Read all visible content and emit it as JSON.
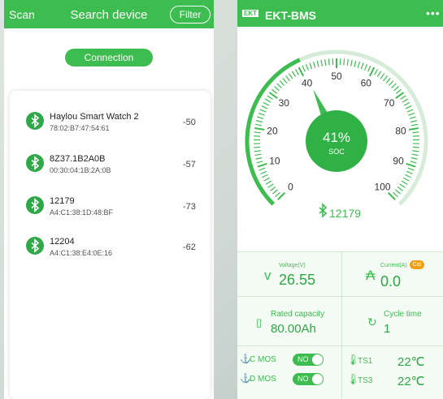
{
  "scan_screen": {
    "scan_label": "Scan",
    "title": "Search device",
    "filter_label": "Filter",
    "connection_label": "Connection",
    "devices": [
      {
        "name": "Haylou Smart Watch 2",
        "mac": "78:02:B7:47:54:61",
        "rssi": "-50"
      },
      {
        "name": "8Z37.1B2A0B",
        "mac": "00:30:04:1B:2A:0B",
        "rssi": "-57"
      },
      {
        "name": "12179",
        "mac": "A4:C1:38:1D:48:BF",
        "rssi": "-73"
      },
      {
        "name": "12204",
        "mac": "A4:C1:38:E4:0E:16",
        "rssi": "-62"
      }
    ]
  },
  "bms_screen": {
    "logo_text": "EKT",
    "title": "EKT-BMS",
    "menu_icon": "more-dots-icon",
    "gauge": {
      "ticks": [
        "0",
        "10",
        "20",
        "30",
        "40",
        "50",
        "60",
        "70",
        "80",
        "90",
        "100"
      ],
      "soc_value": "41%",
      "soc_label": "SOC",
      "soc_fraction": 0.41,
      "device_name": "12179"
    },
    "voltage": {
      "label": "Voltage(V)",
      "value": "26.55"
    },
    "current": {
      "label": "Current(A)",
      "value": "0.0",
      "cal_label": "Cal"
    },
    "rated_capacity": {
      "label": "Rated capacity",
      "value": "80.00Ah"
    },
    "cycle_time": {
      "label": "Cycle time",
      "value": "1"
    },
    "c_mos": {
      "label": "C MOS",
      "state": "NO"
    },
    "d_mos": {
      "label": "D MOS",
      "state": "NO"
    },
    "ts1": {
      "label": "TS1",
      "value": "22℃"
    },
    "ts3": {
      "label": "TS3",
      "value": "22℃"
    },
    "colors": {
      "accent": "#3dbd4f",
      "gauge_track": "#d6ecd8",
      "cal_badge": "#f0a017"
    }
  }
}
